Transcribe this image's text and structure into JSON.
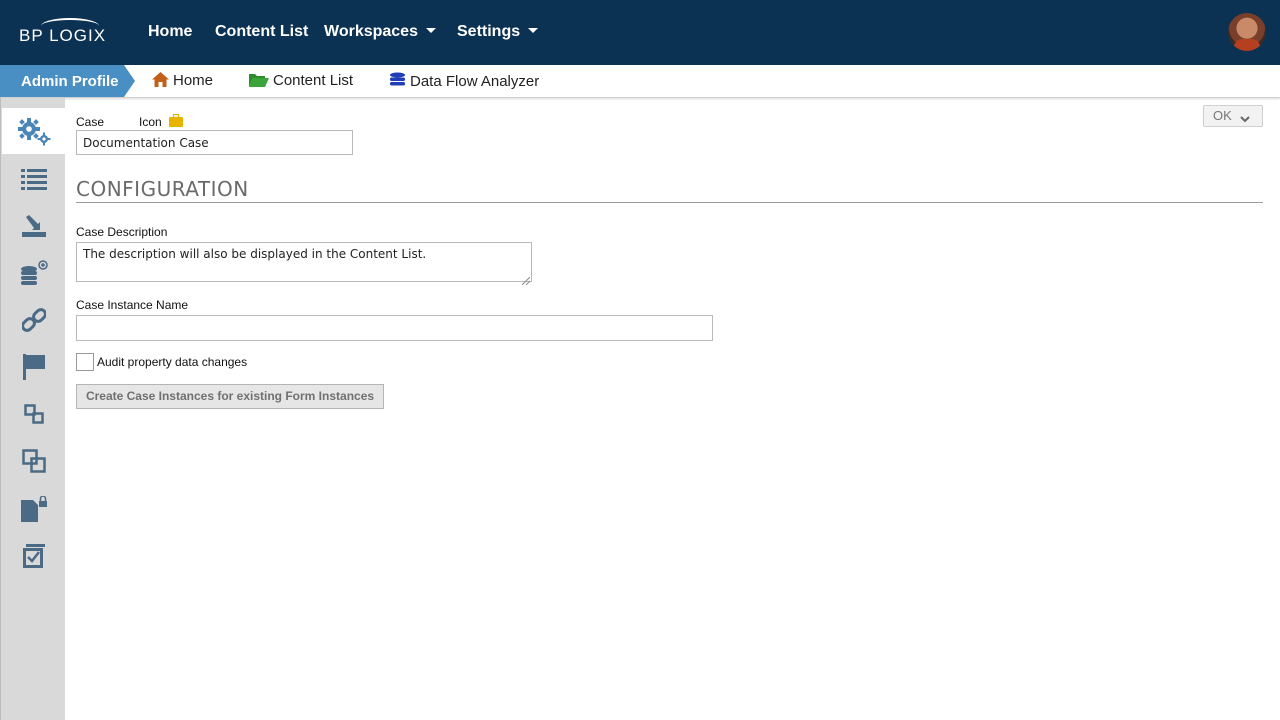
{
  "app": {
    "logo_text": "BP LOGIX"
  },
  "nav": {
    "home": "Home",
    "content_list": "Content List",
    "workspaces": "Workspaces",
    "settings": "Settings"
  },
  "subnav": {
    "admin_profile": "Admin Profile",
    "home": "Home",
    "content_list": "Content List",
    "data_flow_analyzer": "Data Flow Analyzer"
  },
  "sidebar": {
    "items": [
      {
        "icon": "gear-icon",
        "active": true
      },
      {
        "icon": "list-icon"
      },
      {
        "icon": "download-tray-icon"
      },
      {
        "icon": "database-add-icon"
      },
      {
        "icon": "link-icon"
      },
      {
        "icon": "flag-icon"
      },
      {
        "icon": "transfer-icon"
      },
      {
        "icon": "copy-icon"
      },
      {
        "icon": "locked-document-icon"
      },
      {
        "icon": "checkbox-icon"
      }
    ]
  },
  "form": {
    "case_label": "Case",
    "icon_label": "Icon",
    "case_value": "Documentation Case",
    "section_title": "CONFIGURATION",
    "description_label": "Case Description",
    "description_value": "The description will also be displayed in the Content List.",
    "instance_name_label": "Case Instance Name",
    "instance_name_value": "",
    "audit_label": "Audit property data changes",
    "audit_checked": false,
    "create_button": "Create Case Instances for existing Form Instances",
    "ok_button": "OK"
  },
  "colors": {
    "topbar": "#0c3253",
    "accent": "#4a8fc4",
    "sidebar": "#d9d9d9",
    "icon": "#4a6a86"
  }
}
